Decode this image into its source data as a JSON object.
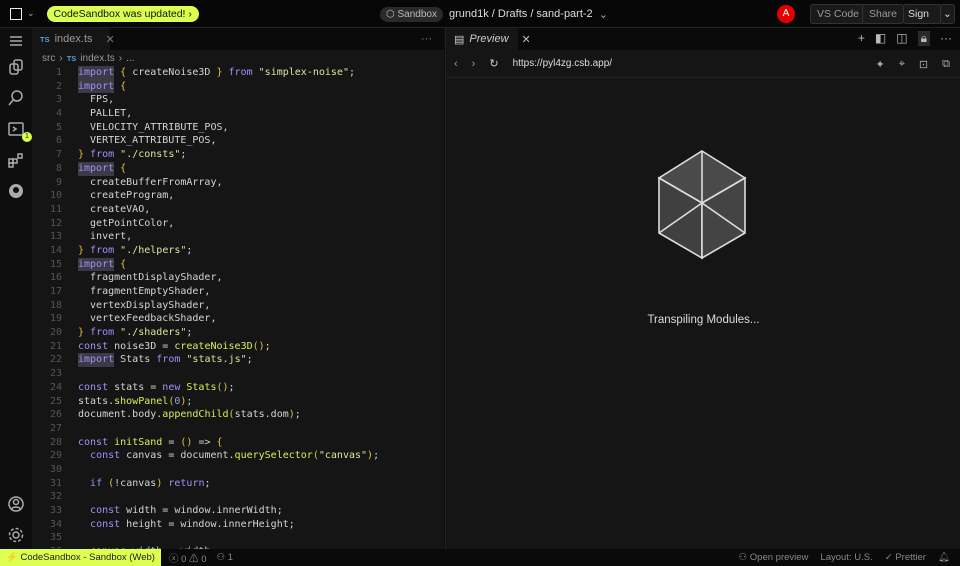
{
  "topbar": {
    "update_label": "CodeSandbox was updated!",
    "update_chevron": "›",
    "sandbox_badge": "Sandbox",
    "path": "grund1k / Drafts / sand-part-2",
    "avatar": "A",
    "vscode": "VS Code",
    "share": "Share",
    "signin": "Sign In"
  },
  "activity": {
    "badge": "1"
  },
  "editor": {
    "tab": {
      "lang": "TS",
      "name": "index.ts"
    },
    "breadcrumb": [
      "src",
      "index.ts",
      "..."
    ],
    "lines": [
      [
        [
          "kw",
          "import",
          1
        ],
        [
          "br",
          " { "
        ],
        [
          "pl",
          "createNoise3D"
        ],
        [
          "br",
          " } "
        ],
        [
          "kw",
          "from"
        ],
        [
          "pl",
          " "
        ],
        [
          "str",
          "\"simplex-noise\""
        ],
        [
          "pl",
          ";"
        ]
      ],
      [
        [
          "kw",
          "import",
          1
        ],
        [
          "br",
          " {"
        ]
      ],
      [
        [
          "pl",
          "  FPS,"
        ]
      ],
      [
        [
          "pl",
          "  PALLET,"
        ]
      ],
      [
        [
          "pl",
          "  VELOCITY_ATTRIBUTE_POS,"
        ]
      ],
      [
        [
          "pl",
          "  VERTEX_ATTRIBUTE_POS,"
        ]
      ],
      [
        [
          "br",
          "} "
        ],
        [
          "kw",
          "from"
        ],
        [
          "pl",
          " "
        ],
        [
          "str",
          "\"./consts\""
        ],
        [
          "pl",
          ";"
        ]
      ],
      [
        [
          "kw",
          "import",
          1
        ],
        [
          "br",
          " {"
        ]
      ],
      [
        [
          "pl",
          "  createBufferFromArray,"
        ]
      ],
      [
        [
          "pl",
          "  createProgram,"
        ]
      ],
      [
        [
          "pl",
          "  createVAO,"
        ]
      ],
      [
        [
          "pl",
          "  getPointColor,"
        ]
      ],
      [
        [
          "pl",
          "  invert,"
        ]
      ],
      [
        [
          "br",
          "} "
        ],
        [
          "kw",
          "from"
        ],
        [
          "pl",
          " "
        ],
        [
          "str",
          "\"./helpers\""
        ],
        [
          "pl",
          ";"
        ]
      ],
      [
        [
          "kw",
          "import",
          1
        ],
        [
          "br",
          " {"
        ]
      ],
      [
        [
          "pl",
          "  fragmentDisplayShader,"
        ]
      ],
      [
        [
          "pl",
          "  fragmentEmptyShader,"
        ]
      ],
      [
        [
          "pl",
          "  vertexDisplayShader,"
        ]
      ],
      [
        [
          "pl",
          "  vertexFeedbackShader,"
        ]
      ],
      [
        [
          "br",
          "} "
        ],
        [
          "kw",
          "from"
        ],
        [
          "pl",
          " "
        ],
        [
          "str",
          "\"./shaders\""
        ],
        [
          "pl",
          ";"
        ]
      ],
      [
        [
          "kw",
          "const"
        ],
        [
          "pl",
          " noise3D = "
        ],
        [
          "fn",
          "createNoise3D"
        ],
        [
          "br",
          "()"
        ],
        [
          "pl",
          ";"
        ]
      ],
      [
        [
          "kw",
          "import",
          1
        ],
        [
          "pl",
          " Stats "
        ],
        [
          "kw",
          "from"
        ],
        [
          "pl",
          " "
        ],
        [
          "str",
          "\"stats.js\""
        ],
        [
          "pl",
          ";"
        ]
      ],
      [],
      [
        [
          "kw",
          "const"
        ],
        [
          "pl",
          " stats = "
        ],
        [
          "kw",
          "new"
        ],
        [
          "pl",
          " "
        ],
        [
          "fn",
          "Stats"
        ],
        [
          "br",
          "()"
        ],
        [
          "pl",
          ";"
        ]
      ],
      [
        [
          "pl",
          "stats."
        ],
        [
          "fn",
          "showPanel"
        ],
        [
          "br",
          "("
        ],
        [
          "nm",
          "0"
        ],
        [
          "br",
          ")"
        ],
        [
          "pl",
          ";"
        ]
      ],
      [
        [
          "pl",
          "document.body."
        ],
        [
          "fn",
          "appendChild"
        ],
        [
          "br",
          "("
        ],
        [
          "pl",
          "stats.dom"
        ],
        [
          "br",
          ")"
        ],
        [
          "pl",
          ";"
        ]
      ],
      [],
      [
        [
          "kw",
          "const"
        ],
        [
          "pl",
          " "
        ],
        [
          "fn",
          "initSand"
        ],
        [
          "pl",
          " = "
        ],
        [
          "br",
          "()"
        ],
        [
          "pl",
          " => "
        ],
        [
          "br",
          "{"
        ]
      ],
      [
        [
          "pl",
          "  "
        ],
        [
          "kw",
          "const"
        ],
        [
          "pl",
          " canvas = document."
        ],
        [
          "fn",
          "querySelector"
        ],
        [
          "br",
          "("
        ],
        [
          "str",
          "\"canvas\""
        ],
        [
          "br",
          ")"
        ],
        [
          "pl",
          ";"
        ]
      ],
      [],
      [
        [
          "pl",
          "  "
        ],
        [
          "kw",
          "if"
        ],
        [
          "pl",
          " "
        ],
        [
          "br",
          "("
        ],
        [
          "pl",
          "!canvas"
        ],
        [
          "br",
          ")"
        ],
        [
          "pl",
          " "
        ],
        [
          "kw",
          "return"
        ],
        [
          "pl",
          ";"
        ]
      ],
      [],
      [
        [
          "pl",
          "  "
        ],
        [
          "kw",
          "const"
        ],
        [
          "pl",
          " width = window.innerWidth;"
        ]
      ],
      [
        [
          "pl",
          "  "
        ],
        [
          "kw",
          "const"
        ],
        [
          "pl",
          " height = window.innerHeight;"
        ]
      ],
      [],
      [
        [
          "pl",
          "  canvas.width = width;"
        ]
      ]
    ]
  },
  "preview": {
    "tab": "Preview",
    "url": "https://pyl4zg.csb.app/",
    "loading": "Transpiling Modules..."
  },
  "status": {
    "main": "CodeSandbox - Sandbox (Web)",
    "errors": "0",
    "warnings": "0",
    "ports": "1",
    "open_preview": "Open preview",
    "layout": "Layout: U.S.",
    "prettier": "Prettier"
  },
  "colors": {
    "accent": "#dcff50",
    "avatar": "#e50000"
  }
}
